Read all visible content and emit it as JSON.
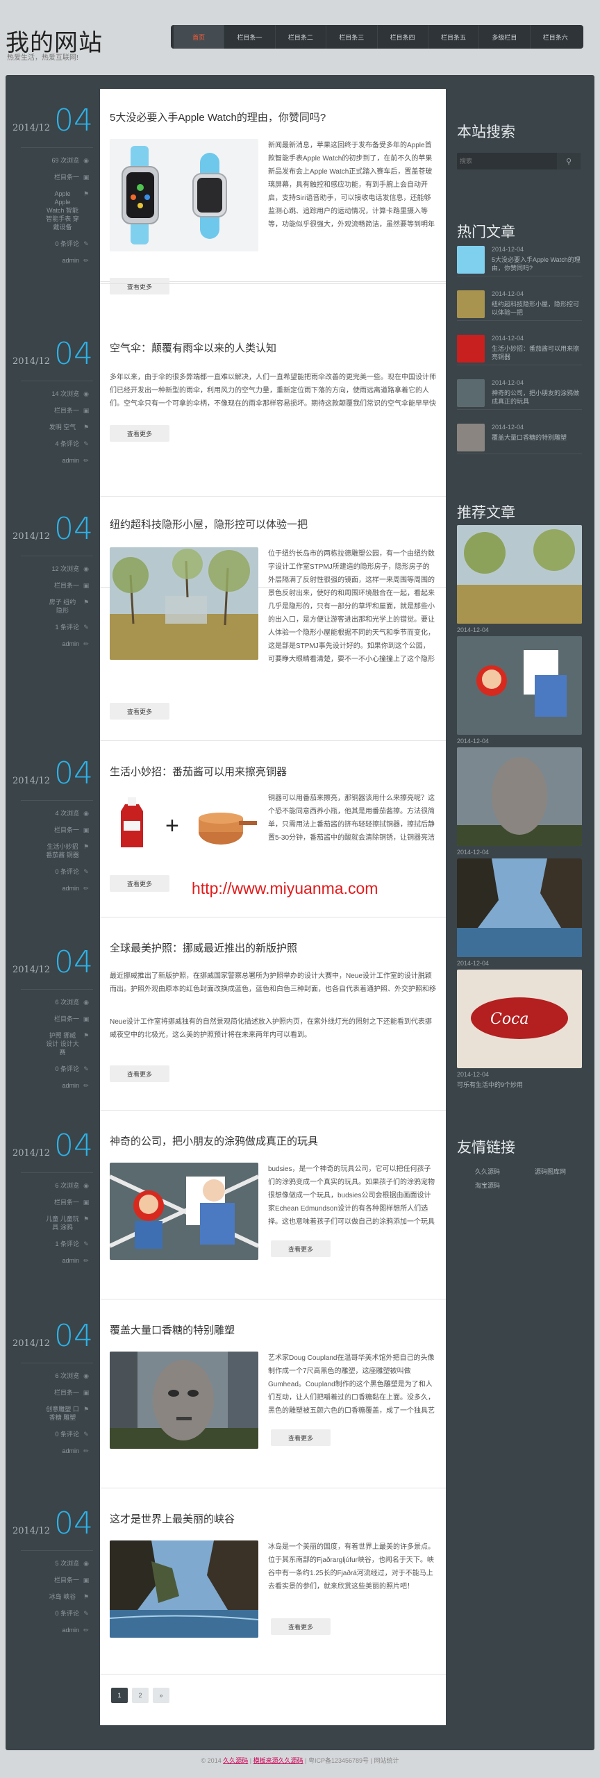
{
  "site": {
    "logo": "我的网站",
    "tagline": "热爱生活，热爱互联网!"
  },
  "nav": [
    "首页",
    "栏目条一",
    "栏目条二",
    "栏目条三",
    "栏目条四",
    "栏目条五",
    "多级栏目",
    "栏目条六"
  ],
  "posts": [
    {
      "title": "5大没必要入手Apple Watch的理由，你赞同吗?",
      "ym": "2014/12",
      "day": "04",
      "views": "69 次浏览",
      "category": "栏目条一",
      "tags": "Apple Apple Watch 智能 智能手表 穿戴设备",
      "comments": "0 条评论",
      "author": "admin",
      "text": "新闻最新消息，苹果这回终于发布备受多年的Apple首款智能手表Apple Watch的初步到了，在前不久的苹果新品发布会上Apple Watch正式踏入赛车后，置盖苍玻璃屏幕，具有触控和感应功能，有到手腕上会自动开启，支持Siri语音助手，可以接收电话发信息，还能够监测心跳、追踪用户的运动情况，计算卡路里摄入等等，功能似乎很强大，外观流畅简洁，虽然要等到明年才会上市，但是许多苹果迷已经做好抢购的准备了。不过，对于这么强大的Apple Watch互联网新闻播客mashable.com的编者Todd Wasserman确有不同看法，他出5大理由不必要入手Apple Watch。",
      "more": "查看更多"
    },
    {
      "title": "空气伞：颠覆有雨伞以来的人类认知",
      "ym": "2014/12",
      "day": "04",
      "views": "14 次浏览",
      "category": "栏目条一",
      "tags": "发明 空气",
      "comments": "4 条评论",
      "author": "admin",
      "text": "多年以来，由于伞的很多弊端都一直难以解决，人们一直希望能把雨伞改善的更完美一些。现在中国设计师们已经开发出一种新型的雨伞，利用风力的空气力量，重新定位雨下落的方向，使雨远离道路拿着它的人们。空气伞只有一个可拿的伞柄，不像现在的雨伞那样容易损坏。期待这款颠覆我们常识的空气伞能早早快上市。",
      "more": "查看更多"
    },
    {
      "title": "纽约超科技隐形小屋，隐形控可以体验一把",
      "ym": "2014/12",
      "day": "04",
      "views": "12 次浏览",
      "category": "栏目条一",
      "tags": "房子 纽约 隐形",
      "comments": "1 条评论",
      "author": "admin",
      "text": "位于纽约长岛市的两栋拉德雕塑公园，有一个由纽约数字设计工作室STPMJ所建造的隐形房子，隐形房子的外层隔满了反射性很强的镜面，这样一来周围等周围的景色反射出来，使好的和周围环境融合在一起，看起来几乎是隐形的，只有一部分的草坪和屋面，就是那些小的出入口，是方便让游客进出那和光学上的错觉。要让人体验一个隐形小屋能根据不同的天气和季节而变化，这是部是STPMJ事先设计好的。如果你到这个公园，可要睁大眼睛看清楚，要不一不小心撞撞上了这个隐形的小屋就惨了。",
      "more": "查看更多"
    },
    {
      "title": "生活小妙招：番茄酱可以用来擦亮铜器",
      "ym": "2014/12",
      "day": "04",
      "views": "4 次浏览",
      "category": "栏目条一",
      "tags": "生活小妙招 番茄酱 铜器",
      "comments": "0 条评论",
      "author": "admin",
      "text": "铜器可以用番茄来擦亮，那铜器该用什么来擦亮呢？这个恐不能同意西养小瓶，他其是用番茄酱擦。方法很简单，只需用法上番茄酱的挤布轻轻擦拭铜器，擦拭后静置5-30分钟，番茄酱中的酸就会清除铜锈，让铜器亮洁如新。",
      "more": "查看更多"
    },
    {
      "title": "全球最美护照：挪威最近推出的新版护照",
      "ym": "2014/12",
      "day": "04",
      "views": "6 次浏览",
      "category": "栏目条一",
      "tags": "护照 挪威 设计 设计大赛",
      "comments": "0 条评论",
      "author": "admin",
      "text": "最近挪威推出了新版护照，在挪威国家警察总署所为护照举办的设计大赛中，Neue设计工作室的设计脱颖而出。护照外观由原本的红色封面改换成蓝色，蓝色和白色三种封面，也各自代表着通护照、外交护照和移民护照。",
      "text2": "Neue设计工作室将挪威独有的自然景观简化描述放入护照内页，在紫外线灯光的照射之下还能看到代表挪威夜空中的北极光，这么美的护照预计将在未来两年内可以看到。",
      "more": "查看更多"
    },
    {
      "title": "神奇的公司，把小朋友的涂鸦做成真正的玩具",
      "ym": "2014/12",
      "day": "04",
      "views": "6 次浏览",
      "category": "栏目条一",
      "tags": "儿童 儿童玩具 涂鸦",
      "comments": "1 条评论",
      "author": "admin",
      "text": "budsies，是一个神奇的玩具公司，它可以把任何孩子们的涂鸦变成一个真实的玩具。如果孩子们的涂鸦宠物很想像做成一个玩具，budsies公司会根据由画面设计家Echean Edmundson设计的有各种图样想所人们选择。这也意味着孩子们可以做自己的涂鸦添加一个玩具变成一个玩具，一个值得棒。",
      "more": "查看更多"
    },
    {
      "title": "覆盖大量口香糖的特别雕塑",
      "ym": "2014/12",
      "day": "04",
      "views": "6 次浏览",
      "category": "栏目条一",
      "tags": "创意雕塑 口香糖 雕塑",
      "comments": "0 条评论",
      "author": "admin",
      "text": "艺术家Doug Coupland在温哥华美术馆外把自己的头像制作成一个7尺高黑色的雕塑，这座雕塑被叫做Gumhead。Coupland制作的这个黑色雕塑是为了和人们互动，让人们把嚼着过的口香糖黏在上面。没多久，黑色的雕塑被五颜六色的口香糖覆盖，成了一个独具艺术感的雕塑。",
      "more": "查看更多"
    },
    {
      "title": "这才是世界上最美丽的峡谷",
      "ym": "2014/12",
      "day": "04",
      "views": "5 次浏览",
      "category": "栏目条一",
      "tags": "冰岛 峡谷",
      "comments": "0 条评论",
      "author": "admin",
      "text": "冰岛是一个美丽的国度，有着世界上最美的许多景点。位于其东南部的Fjaðrargljúfur峡谷，也闻名于天下。峡谷中有一条约1.25长的Fjaðrá河流经过，对于不能马上去看实景的参们，就来欣赏这些美丽的照片吧！",
      "more": "查看更多"
    }
  ],
  "sidebar": {
    "search_title": "本站搜索",
    "search_placeholder": "搜索",
    "hot_title": "热门文章",
    "hot": [
      {
        "date": "2014-12-04",
        "title": "5大没必要入手Apple Watch的理由，你赞同吗?"
      },
      {
        "date": "2014-12-04",
        "title": "纽约超科技隐形小屋，隐形控可以体验一把"
      },
      {
        "date": "2014-12-04",
        "title": "生活小妙招：番茄酱可以用来擦亮铜器"
      },
      {
        "date": "2014-12-04",
        "title": "神奇的公司，把小朋友的涂鸦做成真正的玩具"
      },
      {
        "date": "2014-12-04",
        "title": "覆盖大量口香糖的特别雕塑"
      }
    ],
    "rec_title": "推荐文章",
    "rec": [
      {
        "date": "2014-12-04",
        "title": "纽约超科技隐形小屋，隐形控可以体验一把"
      },
      {
        "date": "2014-12-04",
        "title": "神奇的公司，把小朋友的涂鸦做成真正的玩具"
      },
      {
        "date": "2014-12-04",
        "title": "覆盖大量口香糖的特别雕塑"
      },
      {
        "date": "2014-12-04",
        "title": "这才是世界上最美丽的峡谷"
      },
      {
        "date": "2014-12-04",
        "title": "可乐有生活中的9个妙用"
      }
    ],
    "links_title": "友情链接",
    "links": [
      "久久源码",
      "源码图库网",
      "淘宝源码"
    ]
  },
  "watermark": "http://www.miyuanma.com",
  "pager": [
    "1",
    "2",
    "»"
  ],
  "footer": {
    "copy": "© 2014",
    "site_link": "久久源码",
    "sep": "|",
    "theme_link": "模板来源久久源码",
    "icp": "粤ICP备123456789号",
    "stats": "网站统计"
  },
  "colors": {
    "accent": "#2bb4ea",
    "dark": "#3b4449",
    "nav_active": "#ff5a36",
    "watermark": "#e21b1b"
  }
}
